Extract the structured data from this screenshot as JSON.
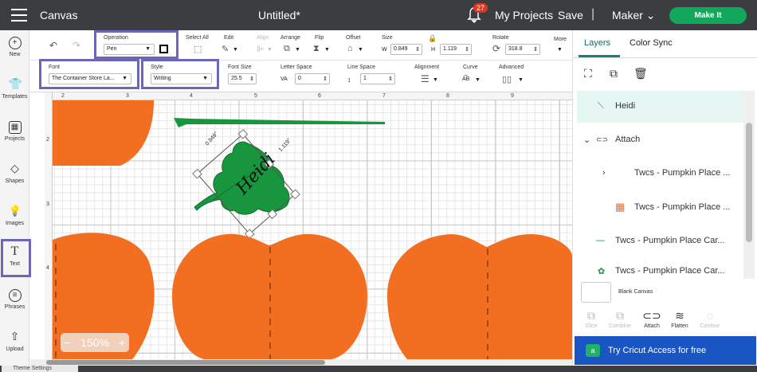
{
  "topbar": {
    "app_title": "Canvas",
    "doc_title": "Untitled*",
    "notification_count": "27",
    "my_projects": "My Projects",
    "save": "Save",
    "separator": "|",
    "machine": "Maker",
    "machine_caret": "⌄",
    "make_it": "Make It"
  },
  "leftnav": {
    "items": [
      {
        "label": "New",
        "icon": "+"
      },
      {
        "label": "Templates",
        "icon": "👕"
      },
      {
        "label": "Projects",
        "icon": "▦"
      },
      {
        "label": "Shapes",
        "icon": "◇"
      },
      {
        "label": "Images",
        "icon": "💡"
      },
      {
        "label": "Text",
        "icon": "T"
      },
      {
        "label": "Phrases",
        "icon": "≡"
      },
      {
        "label": "Upload",
        "icon": "⇧"
      }
    ]
  },
  "toolbar1": {
    "undo_icon": "↶",
    "redo_icon": "↷",
    "operation": {
      "label": "Operation",
      "value": "Pen",
      "caret": "▼"
    },
    "select_all": {
      "label": "Select All",
      "icon": "⬚"
    },
    "edit": {
      "label": "Edit",
      "icon": "✎",
      "caret": "▼"
    },
    "align": {
      "label": "Align",
      "icon": "⊫",
      "caret": "▼"
    },
    "arrange": {
      "label": "Arrange",
      "icon": "⧉",
      "caret": "▼"
    },
    "flip": {
      "label": "Flip",
      "icon": "⧗",
      "caret": "▼"
    },
    "offset": {
      "label": "Offset",
      "icon": "⌂",
      "caret": "▼"
    },
    "size": {
      "label": "Size",
      "w_label": "W",
      "w": "0.849",
      "h_label": "H",
      "h": "1.119",
      "lock_icon": "🔒",
      "stepper": "⇕"
    },
    "rotate": {
      "label": "Rotate",
      "icon": "⟳",
      "value": "318.8",
      "stepper": "⇕"
    },
    "more": {
      "label": "More",
      "caret": "▼"
    }
  },
  "toolbar2": {
    "font": {
      "label": "Font",
      "value": "The Container Store La...",
      "caret": "▼"
    },
    "style": {
      "label": "Style",
      "value": "Writing",
      "caret": "▼"
    },
    "font_size": {
      "label": "Font Size",
      "value": "25.5",
      "stepper": "⇕"
    },
    "letter_space": {
      "label": "Letter Space",
      "icon": "VA",
      "value": "0",
      "stepper": "⇕"
    },
    "line_space": {
      "label": "Line Space",
      "icon": "↕",
      "value": "1",
      "stepper": "⇕"
    },
    "alignment": {
      "label": "Alignment",
      "icon": "☰",
      "caret": "▼"
    },
    "curve": {
      "label": "Curve",
      "icon": "A͡B",
      "caret": "▼"
    },
    "advanced": {
      "label": "Advanced",
      "icon": "▯▯",
      "caret": "▼"
    }
  },
  "ruler": {
    "top": [
      "2",
      "3",
      "4",
      "5",
      "6",
      "7",
      "8",
      "9"
    ],
    "left": [
      "2",
      "3",
      "4"
    ]
  },
  "canvas": {
    "text_object": "Heidi",
    "width_dim": "0.849\"",
    "height_dim": "1.119\"",
    "zoom": "150%",
    "zoom_minus": "−",
    "zoom_plus": "+"
  },
  "rightpanel": {
    "tabs": [
      "Layers",
      "Color Sync"
    ],
    "layer_icons": {
      "group": "⛶",
      "duplicate": "⧉",
      "delete": "🗑"
    },
    "layers": [
      {
        "label": "Heidi",
        "icon": "⟍"
      },
      {
        "label": "Attach",
        "icon": "⊂⊃",
        "caret": "⌄"
      },
      {
        "label": "Twcs - Pumpkin Place ...",
        "caret": "›"
      },
      {
        "label": "Twcs - Pumpkin Place ...",
        "icon": "▦"
      },
      {
        "label": "Twcs - Pumpkin Place Car...",
        "icon": "—"
      },
      {
        "label": "Twcs - Pumpkin Place Car...",
        "icon": "✿"
      }
    ],
    "blank_canvas": "Blank Canvas",
    "actions": [
      {
        "label": "Slice",
        "icon": "⧉"
      },
      {
        "label": "Combine",
        "icon": "⧉"
      },
      {
        "label": "Attach",
        "icon": "⊂⊃"
      },
      {
        "label": "Flatten",
        "icon": "≋"
      },
      {
        "label": "Contour",
        "icon": "◌"
      }
    ],
    "cricut_access": "Try Cricut Access for free",
    "cricut_icon": "a"
  },
  "footer": {
    "theme_settings": "Theme Settings"
  },
  "colors": {
    "pumpkin": "#f26f21",
    "leaf": "#17963e",
    "accent": "#12a85b",
    "highlight": "#6b66b8",
    "cricut": "#1a55c4"
  }
}
